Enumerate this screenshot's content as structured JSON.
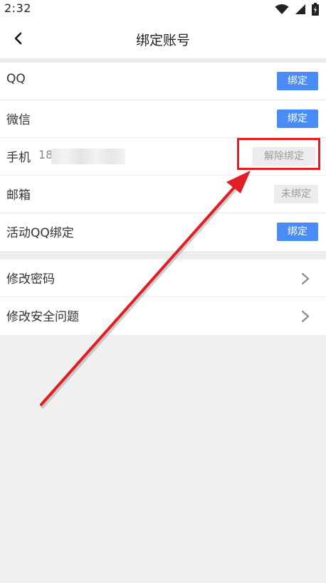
{
  "status_bar": {
    "time": "2:32"
  },
  "header": {
    "title": "绑定账号",
    "back_icon": "chevron-left-icon"
  },
  "bindings": [
    {
      "label": "QQ",
      "value": "",
      "action": "绑定",
      "state": "unbound-primary"
    },
    {
      "label": "微信",
      "value": "",
      "action": "绑定",
      "state": "unbound-primary"
    },
    {
      "label": "手机",
      "value": "18",
      "action": "解除绑定",
      "state": "bound"
    },
    {
      "label": "邮箱",
      "value": "",
      "action": "未绑定",
      "state": "disabled"
    },
    {
      "label": "活动QQ绑定",
      "value": "",
      "action": "绑定",
      "state": "unbound-primary"
    }
  ],
  "security": [
    {
      "label": "修改密码"
    },
    {
      "label": "修改安全问题"
    }
  ],
  "colors": {
    "primary": "#4a8cf7",
    "highlight": "#e21e25",
    "background": "#f0f0f0"
  }
}
